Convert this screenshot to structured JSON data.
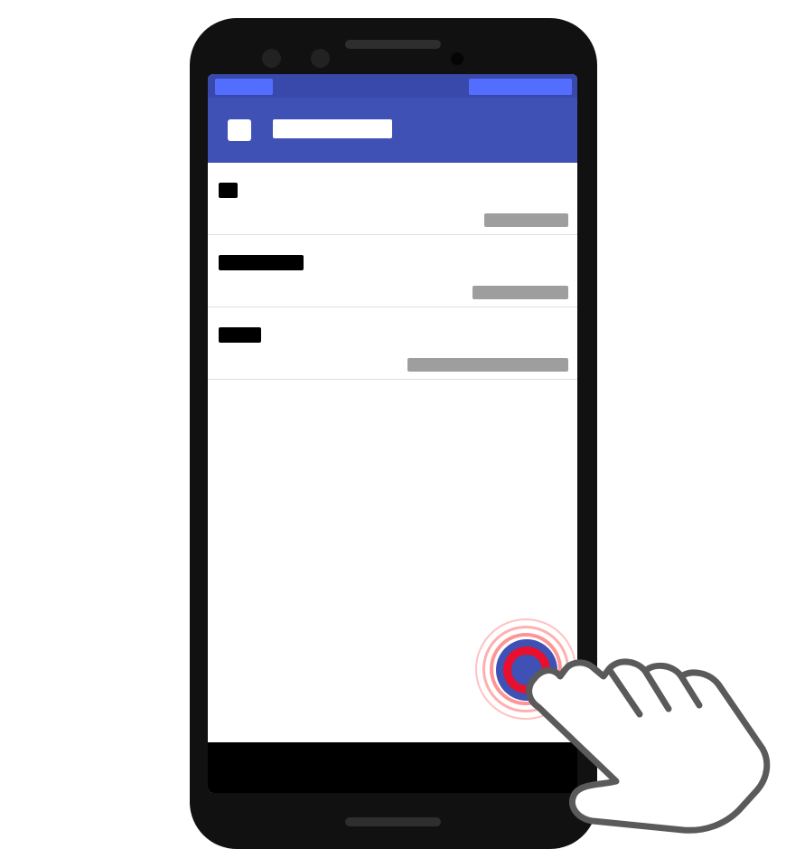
{
  "status_bar": {
    "left": "",
    "right": ""
  },
  "app_bar": {
    "title": ""
  },
  "list": {
    "items": [
      {
        "title": "",
        "subtitle": ""
      },
      {
        "title": "",
        "subtitle": ""
      },
      {
        "title": "",
        "subtitle": ""
      }
    ]
  },
  "fab": {
    "icon": "add-icon"
  },
  "colors": {
    "primary": "#3f51b5",
    "primary_dark": "#3949ab",
    "accent": "#536dfe",
    "tap_ripple": "#e8102c"
  }
}
